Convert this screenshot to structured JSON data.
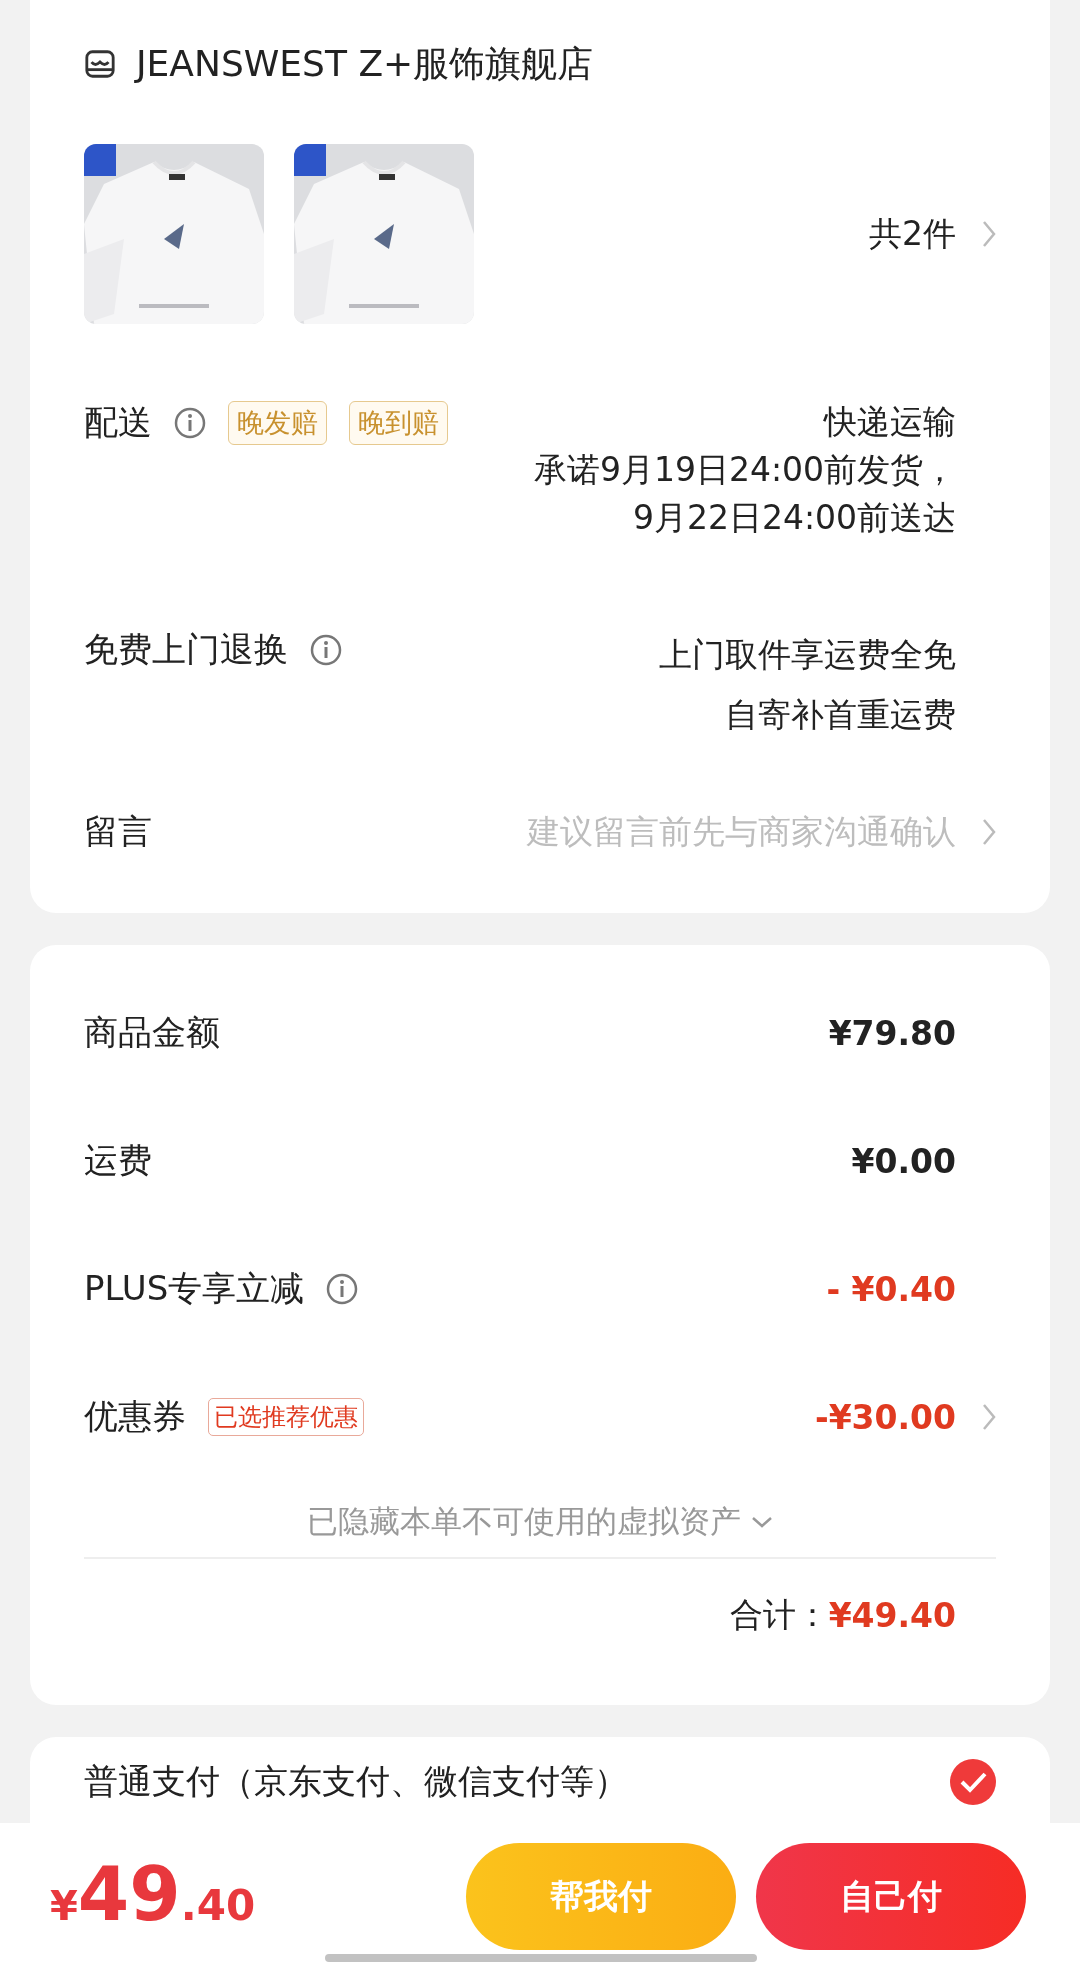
{
  "store": {
    "name": "JEANSWEST Z+服饰旗舰店"
  },
  "products": {
    "count": "共2件"
  },
  "delivery": {
    "label": "配送",
    "badges": [
      "晚发赔",
      "晚到赔"
    ],
    "method": "快递运输",
    "promise": [
      "承诺9月19日24:00前发货，",
      "9月22日24:00前送达"
    ]
  },
  "returns": {
    "label": "免费上门退换",
    "lines": [
      "上门取件享运费全免",
      "自寄补首重运费"
    ]
  },
  "message": {
    "label": "留言",
    "placeholder": "建议留言前先与商家沟通确认"
  },
  "price_rows": [
    {
      "label": "商品金额",
      "value": "¥79.80",
      "kind": "normal"
    },
    {
      "label": "运费",
      "value": "¥0.00",
      "kind": "normal"
    },
    {
      "label": "PLUS专享立减",
      "value": "- ¥0.40",
      "kind": "discount",
      "info": true
    },
    {
      "label": "优惠券",
      "tag": "已选推荐优惠",
      "value": "-¥30.00",
      "kind": "discount",
      "chevron": true
    }
  ],
  "hidden_assets": "已隐藏本单不可使用的虚拟资产",
  "total": {
    "label": "合计：",
    "value": "¥49.40"
  },
  "payment": {
    "option": "普通支付（京东支付、微信支付等）",
    "selected": true
  },
  "bottom_bar": {
    "currency": "¥",
    "integer": "49",
    "decimal": ".40",
    "buttons": [
      "帮我付",
      "自己付"
    ]
  }
}
